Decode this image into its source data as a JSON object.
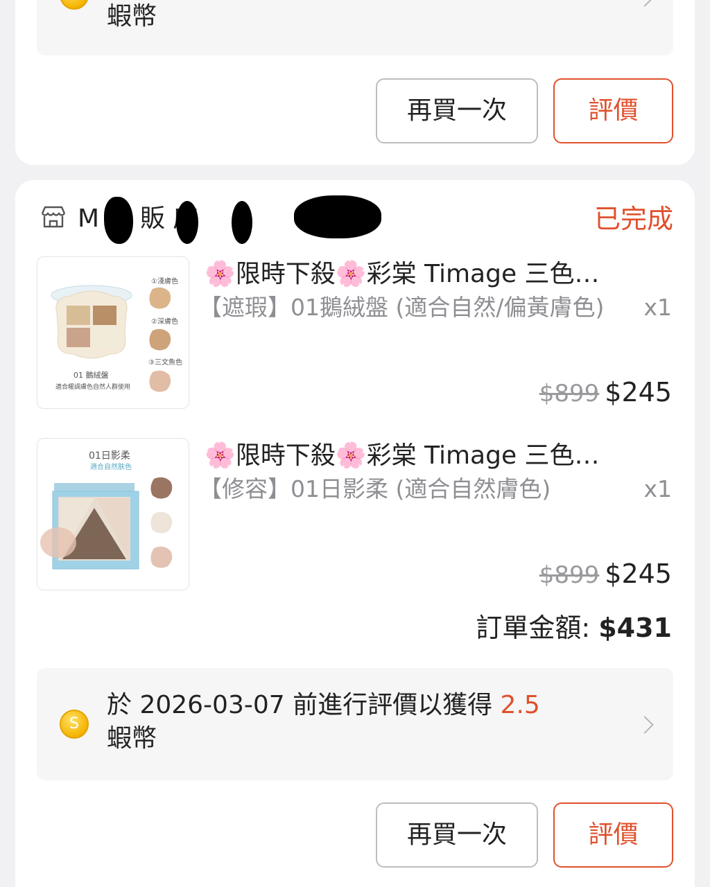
{
  "previous_order": {
    "reward_text_line2": "蝦幣",
    "buy_again_label": "再買一次",
    "review_label": "評價"
  },
  "order": {
    "shop_name_visible": "M  好  販  店",
    "status": "已完成",
    "items": [
      {
        "title": "🌸限時下殺🌸彩棠 Timage 三色…",
        "variant": "【遮瑕】01鵝絨盤 (適合自然/偏黃膚色)",
        "qty": "x1",
        "original_price": "$899",
        "price": "$245",
        "thumb_labels": [
          "①淺膚色",
          "②深膚色",
          "③三文魚色",
          "01 鵝絨盤",
          "適合暖調膚色自然人群使用"
        ]
      },
      {
        "title": "🌸限時下殺🌸彩棠 Timage 三色…",
        "variant": "【修容】01日影柔 (適合自然膚色)",
        "qty": "x1",
        "original_price": "$899",
        "price": "$245",
        "thumb_labels": [
          "01日影柔",
          "適合自然肤色"
        ]
      }
    ],
    "total_label": "訂單金額: ",
    "total_value": "$431",
    "reward_prefix": "於 2026-03-07 前進行評價以獲得 ",
    "reward_amount": "2.5",
    "reward_suffix": "蝦幣",
    "buy_again_label": "再買一次",
    "review_label": "評價"
  },
  "colors": {
    "accent": "#e0502c",
    "muted_text": "#8e8e93",
    "page_background": "#f1f1f3"
  },
  "icons": {
    "coin": "coin-icon",
    "shop": "shop-icon",
    "chevron": "chevron-right-icon"
  }
}
